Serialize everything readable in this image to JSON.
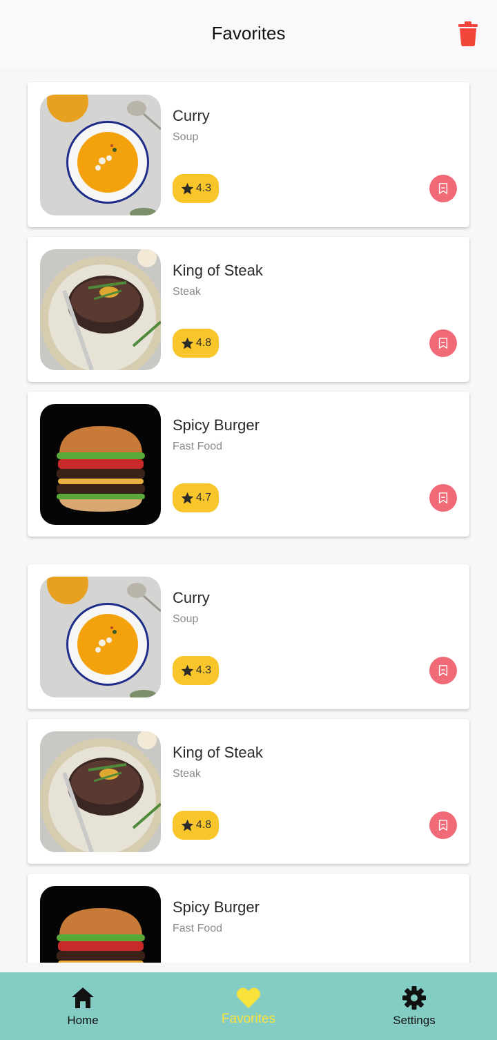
{
  "header": {
    "title": "Favorites",
    "action_icon": "trash-icon"
  },
  "colors": {
    "accent_rating": "#f8c62b",
    "bookmark": "#f16a78",
    "trash": "#f1463a",
    "nav_bg": "#84cdc4",
    "nav_active": "#f9e23b"
  },
  "favorites": [
    {
      "name": "Curry",
      "category": "Soup",
      "rating": "4.3",
      "image": "soup-image"
    },
    {
      "name": "King of Steak",
      "category": "Steak",
      "rating": "4.8",
      "image": "steak-image"
    },
    {
      "name": "Spicy Burger",
      "category": "Fast Food",
      "rating": "4.7",
      "image": "burger-image"
    },
    {
      "name": "Curry",
      "category": "Soup",
      "rating": "4.3",
      "image": "soup-image"
    },
    {
      "name": "King of Steak",
      "category": "Steak",
      "rating": "4.8",
      "image": "steak-image"
    },
    {
      "name": "Spicy Burger",
      "category": "Fast Food",
      "rating": "",
      "image": "burger-image"
    }
  ],
  "nav": [
    {
      "label": "Home",
      "icon": "home-icon"
    },
    {
      "label": "Favorites",
      "icon": "heart-icon",
      "active": true
    },
    {
      "label": "Settings",
      "icon": "gear-icon"
    }
  ]
}
